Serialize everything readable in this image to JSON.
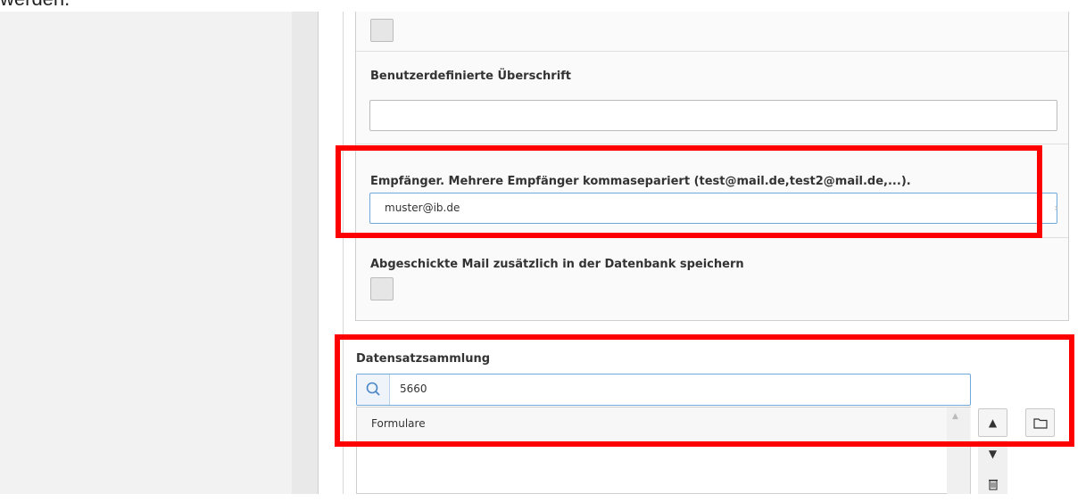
{
  "page": {
    "top_text": "werden."
  },
  "panel": {
    "custom_heading_label": "Benutzerdefinierte Überschrift",
    "custom_heading_value": "",
    "recipient_label": "Empfänger. Mehrere Empfänger kommasepariert (test@mail.de,test2@mail.de,...).",
    "recipient_value": "muster@ib.de",
    "save_mail_label": "Abgeschickte Mail zusätzlich in der Datenbank speichern"
  },
  "record_collection": {
    "label": "Datensatzsammlung",
    "search_value": "5660",
    "items": [
      "Formulare"
    ]
  },
  "icons": {
    "search": "search-icon",
    "move_up": "arrow-up-icon",
    "move_down": "arrow-down-icon",
    "browse": "folder-icon",
    "delete": "trash-icon"
  },
  "colors": {
    "highlight": "#ff0000",
    "focus_border": "#6ea9dc"
  }
}
